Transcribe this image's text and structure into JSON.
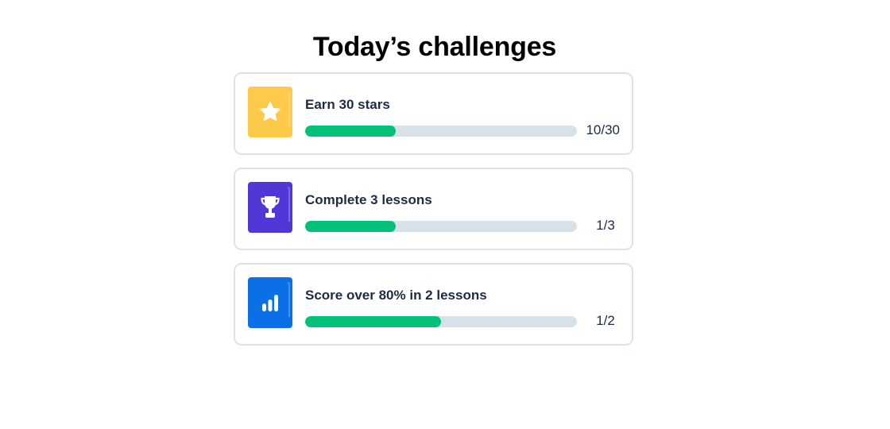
{
  "page": {
    "title": "Today’s challenges"
  },
  "challenges": [
    {
      "title": "Earn 30 stars",
      "progress_text": "10/30",
      "progress": 0.333,
      "icon": "star-icon",
      "color": "#ffc94a"
    },
    {
      "title": "Complete 3 lessons",
      "progress_text": "1/3",
      "progress": 0.333,
      "icon": "trophy-icon",
      "color": "#5137d8"
    },
    {
      "title": "Score over 80% in 2 lessons",
      "progress_text": "1/2",
      "progress": 0.5,
      "icon": "bar-chart-icon",
      "color": "#0b6fe6"
    }
  ],
  "colors": {
    "progress_fill": "#00c07a",
    "progress_track": "#d9e1e8",
    "card_border": "#dbe2ea"
  }
}
